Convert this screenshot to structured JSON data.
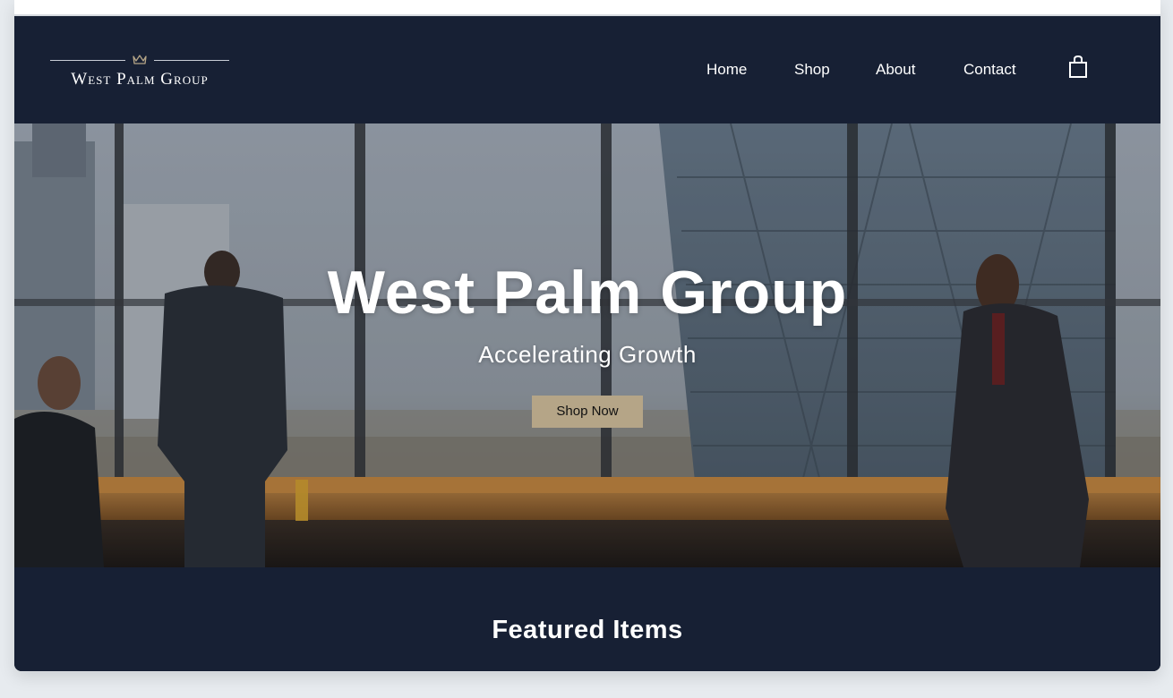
{
  "brand": {
    "name": "West Palm Group",
    "logo_icon": "crown-icon"
  },
  "nav": {
    "items": [
      {
        "label": "Home"
      },
      {
        "label": "Shop"
      },
      {
        "label": "About"
      },
      {
        "label": "Contact"
      }
    ],
    "cart_icon": "shopping-bag-icon"
  },
  "hero": {
    "title": "West Palm Group",
    "subtitle": "Accelerating Growth",
    "cta_label": "Shop Now"
  },
  "featured": {
    "title": "Featured Items"
  },
  "colors": {
    "header_bg": "#172034",
    "cta_bg": "#b5a587",
    "page_bg": "#e7ebef"
  }
}
